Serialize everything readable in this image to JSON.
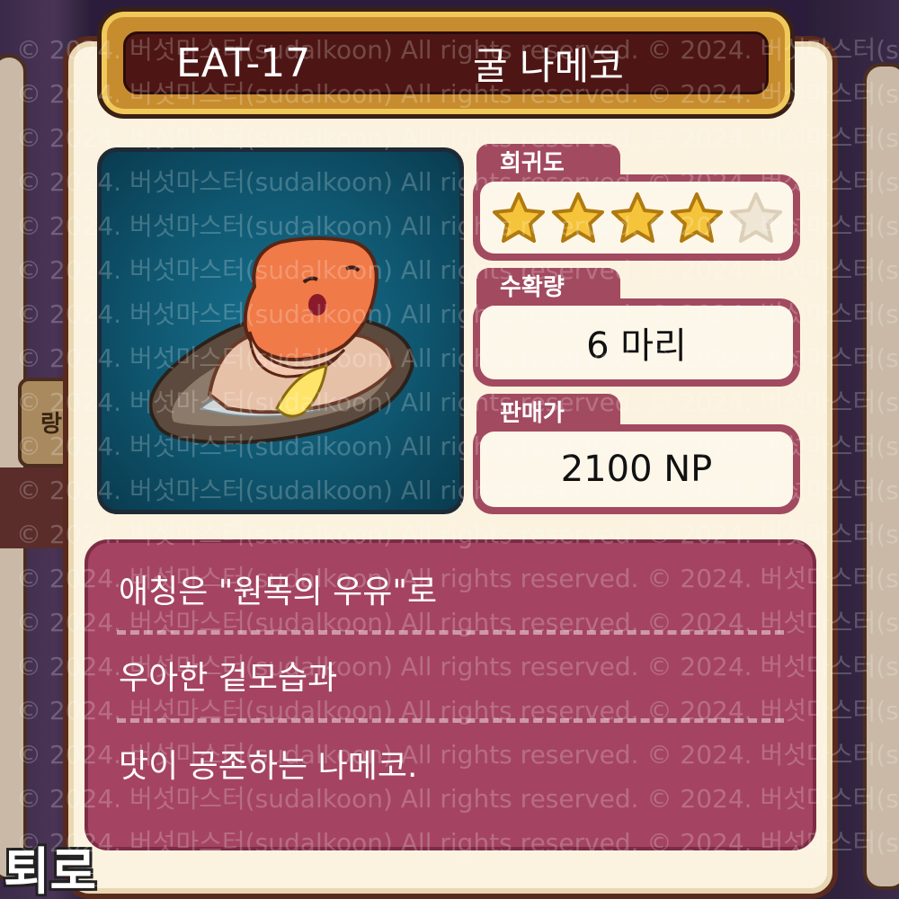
{
  "item": {
    "code": "EAT-17",
    "name": "굴 나메코"
  },
  "rarity": {
    "label": "희귀도",
    "stars_filled": 4,
    "stars_total": 5
  },
  "harvest": {
    "label": "수확량",
    "value": "6 마리"
  },
  "price": {
    "label": "판매가",
    "value": "2100 NP"
  },
  "description": {
    "lines": [
      "애칭은 \"원목의 우유\"로",
      "우아한 겉모습과",
      "맛이 공존하는 나메코."
    ]
  },
  "background": {
    "left_tag": "랑",
    "bottom_text": "퇴로"
  },
  "watermark": {
    "text": "© 2024. 버섯마스터(sudalkoon) All rights reserved."
  },
  "colors": {
    "accent": "#a44462",
    "frame": "#5a2a1e",
    "title_bg": "#4d1614",
    "star": "#f5c43a"
  },
  "icons": {
    "star_filled": "star-icon",
    "star_empty": "star-empty-icon",
    "portrait": "oyster-nameko-icon"
  }
}
